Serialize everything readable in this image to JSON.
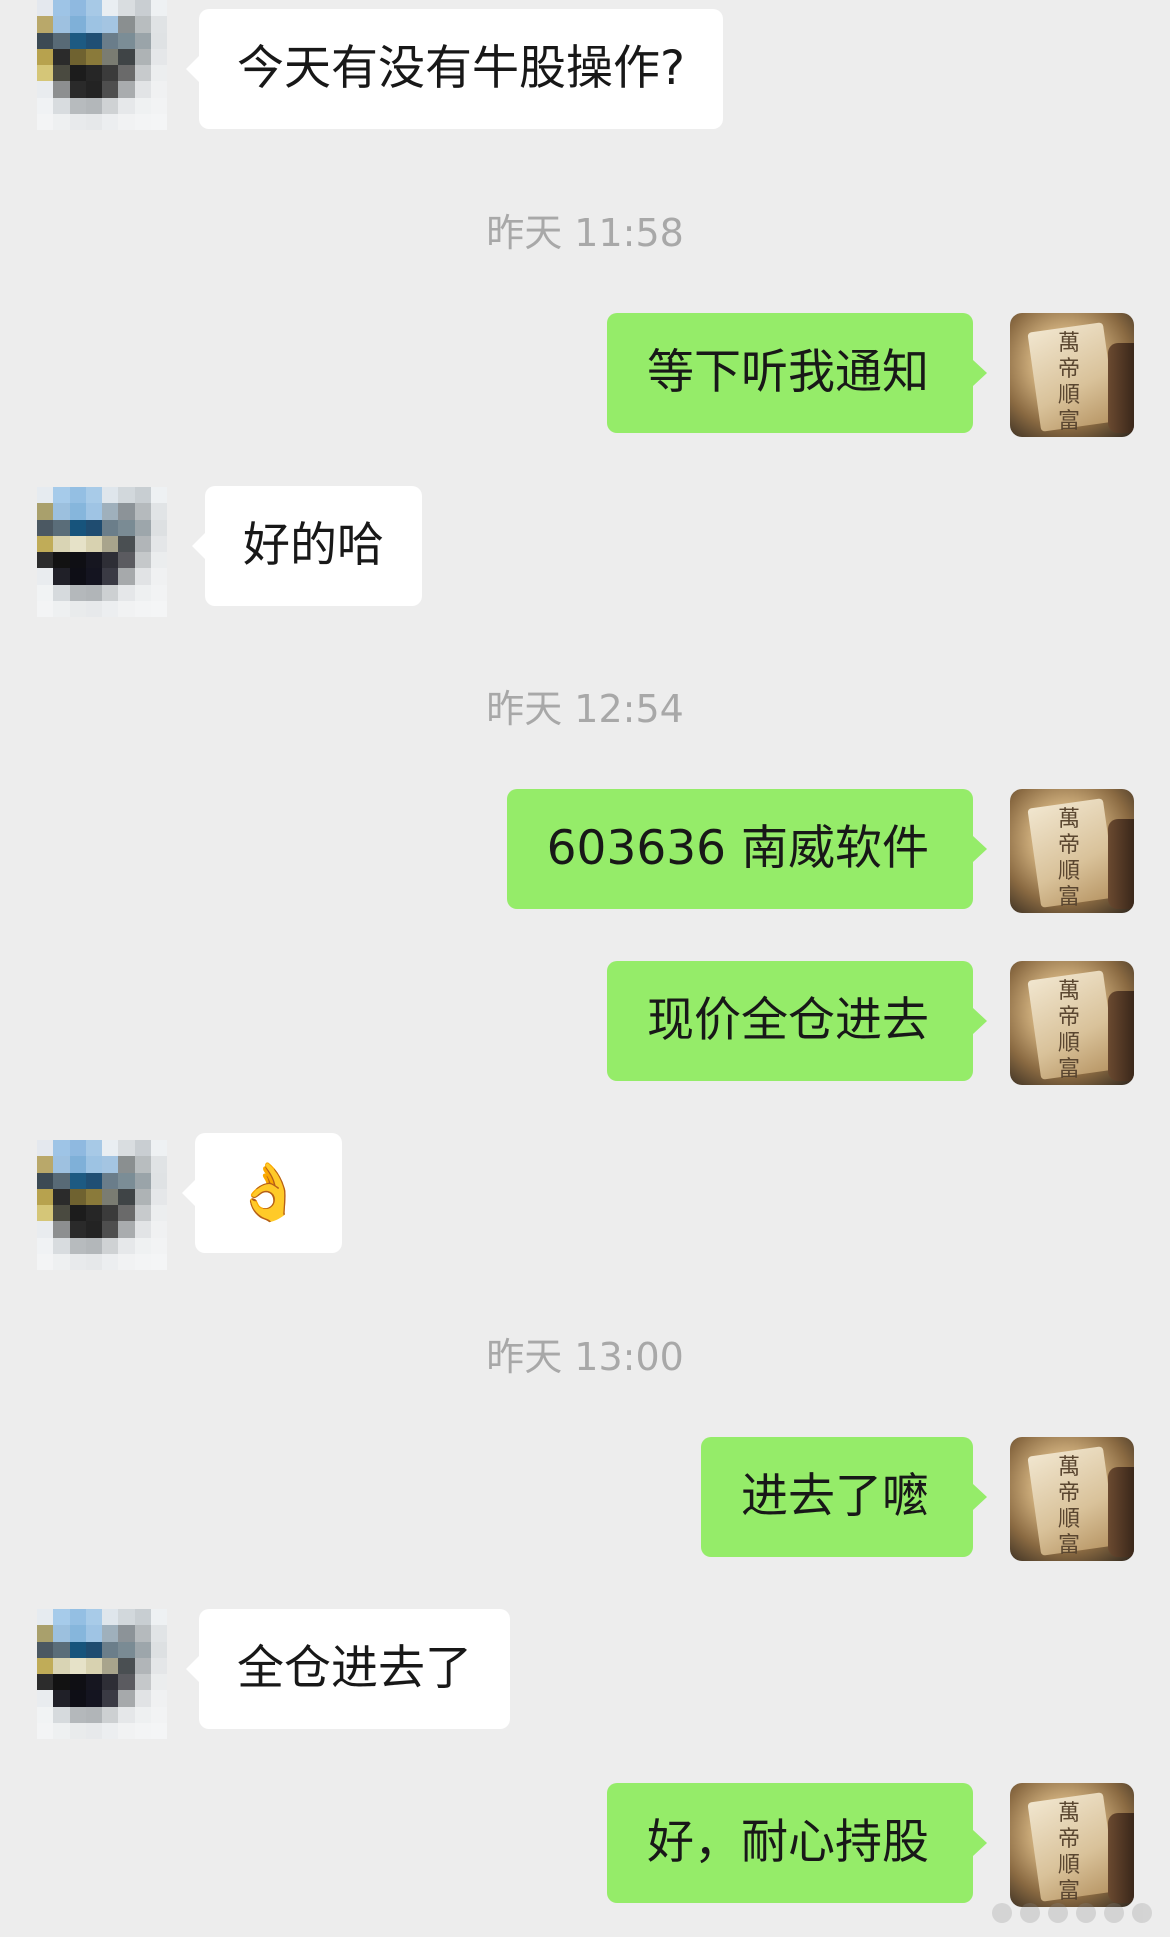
{
  "colors": {
    "background": "#ededed",
    "incoming_bubble": "#ffffff",
    "outgoing_bubble": "#95ec69",
    "timestamp": "#a8a8a8"
  },
  "icons": {
    "contact_avatar": "pixelated-avatar-icon",
    "own_avatar": "scroll-calligraphy-avatar-icon",
    "ok_emoji": "ok-hand-emoji"
  },
  "messages": [
    {
      "side": "in",
      "text": "今天有没有牛股操作?"
    },
    {
      "type": "time",
      "text": "昨天 11:58"
    },
    {
      "side": "out",
      "text": "等下听我通知"
    },
    {
      "side": "in",
      "text": "好的哈"
    },
    {
      "type": "time",
      "text": "昨天 12:54"
    },
    {
      "side": "out",
      "text": "603636 南威软件"
    },
    {
      "side": "out",
      "text": "现价全仓进去"
    },
    {
      "side": "in",
      "text": "👌"
    },
    {
      "type": "time",
      "text": "昨天 13:00"
    },
    {
      "side": "out",
      "text": "进去了嚒"
    },
    {
      "side": "in",
      "text": "全仓进去了"
    },
    {
      "side": "out",
      "text": "好，耐心持股"
    }
  ]
}
